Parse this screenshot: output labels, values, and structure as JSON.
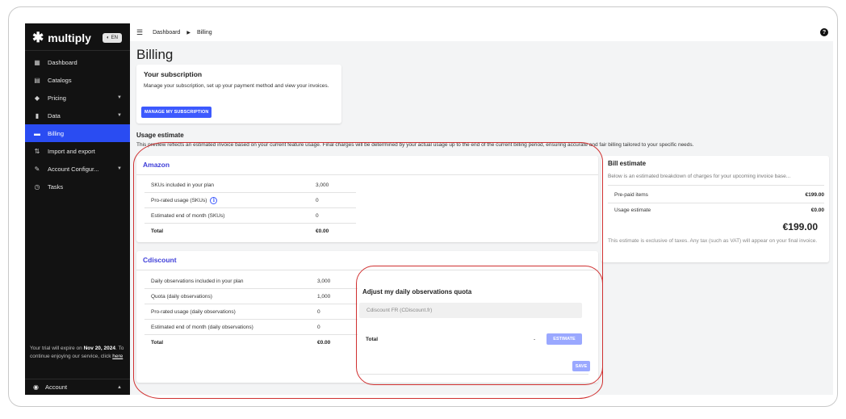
{
  "brand": {
    "name": "multiply",
    "language": "EN"
  },
  "sidebar": {
    "items": [
      {
        "label": "Dashboard",
        "icon": "dashboard-icon",
        "active": false,
        "expandable": false
      },
      {
        "label": "Catalogs",
        "icon": "catalog-icon",
        "active": false,
        "expandable": false
      },
      {
        "label": "Pricing",
        "icon": "tag-icon",
        "active": false,
        "expandable": true
      },
      {
        "label": "Data",
        "icon": "chart-icon",
        "active": false,
        "expandable": true
      },
      {
        "label": "Billing",
        "icon": "card-icon",
        "active": true,
        "expandable": false
      },
      {
        "label": "Import and export",
        "icon": "import-export-icon",
        "active": false,
        "expandable": false
      },
      {
        "label": "Account Configur...",
        "icon": "wrench-icon",
        "active": false,
        "expandable": true
      },
      {
        "label": "Tasks",
        "icon": "clock-icon",
        "active": false,
        "expandable": false
      }
    ],
    "trial": {
      "prefix": "Your trial will expire on ",
      "date": "Nov 20, 2024",
      "middle": ". To continue enjoying our service, click ",
      "link": "here"
    },
    "account_label": "Account"
  },
  "topbar": {
    "breadcrumb": [
      "Dashboard",
      "Billing"
    ]
  },
  "page_title": "Billing",
  "subscription": {
    "title": "Your subscription",
    "description": "Manage your subscription, set up your payment method and view your invoices.",
    "button": "MANAGE MY SUBSCRIPTION"
  },
  "usage": {
    "title": "Usage estimate",
    "description": "This preview reflects an estimated invoice based on your current feature usage. Final charges will be determined by your actual usage up to the end of the current billing period, ensuring accurate and fair billing tailored to your specific needs."
  },
  "amazon": {
    "title": "Amazon",
    "rows": [
      {
        "label": "SKUs included in your plan",
        "value": "3,000"
      },
      {
        "label": "Pro-rated usage (SKUs)",
        "value": "0"
      },
      {
        "label": "Estimated end of month (SKUs)",
        "value": "0"
      },
      {
        "label": "Total",
        "value": "€0.00"
      }
    ]
  },
  "cdiscount": {
    "title": "Cdiscount",
    "rows": [
      {
        "label": "Daily observations included in your plan",
        "value": "3,000"
      },
      {
        "label": "Quota (daily observations)",
        "value": "1,000"
      },
      {
        "label": "Pro-rated usage (daily observations)",
        "value": "0"
      },
      {
        "label": "Estimated end of month (daily observations)",
        "value": "0"
      },
      {
        "label": "Total",
        "value": "€0.00"
      }
    ],
    "quota": {
      "title": "Adjust my daily observations quota",
      "select_value": "Cdiscount FR (CDiscount.fr)",
      "total_label": "Total",
      "total_value": "-",
      "estimate_button": "ESTIMATE",
      "save_button": "SAVE"
    }
  },
  "bill": {
    "title": "Bill estimate",
    "description": "Below is an estimated breakdown of charges for your upcoming invoice base...",
    "rows": [
      {
        "label": "Pre-paid items",
        "value": "€199.00"
      },
      {
        "label": "Usage estimate",
        "value": "€0.00"
      }
    ],
    "total": "€199.00",
    "note": "This estimate is exclusive of taxes. Any tax (such as VAT) will appear on your final invoice."
  },
  "colors": {
    "accent": "#3d5afe",
    "active_nav": "#2a4cf2",
    "annotation": "#d03030"
  }
}
